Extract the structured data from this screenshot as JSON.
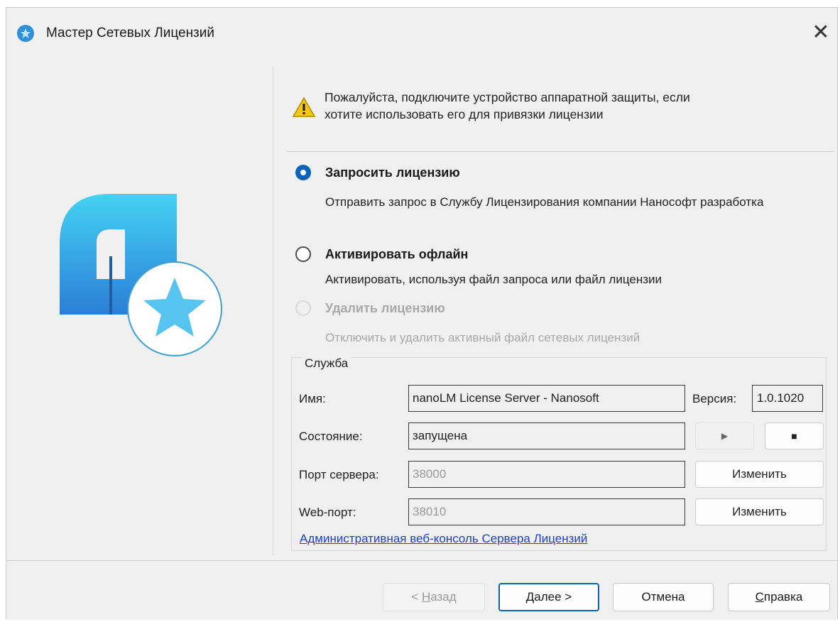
{
  "window": {
    "title": "Мастер Сетевых Лицензий",
    "close_glyph": "✕"
  },
  "warning": {
    "icon": "warning-icon",
    "line1": "Пожалуйста, подключите устройство аппаратной защиты, если",
    "line2": "хотите использовать его для привязки лицензии"
  },
  "options": [
    {
      "label": "Запросить лицензию",
      "desc": "Отправить запрос в Службу Лицензирования компании Нанософт разработка",
      "selected": true,
      "disabled": false
    },
    {
      "label": "Активировать офлайн",
      "desc": "Активировать, используя файл запроса или файл лицензии",
      "selected": false,
      "disabled": false
    },
    {
      "label": "Удалить лицензию",
      "desc": "Отключить и удалить активный файл сетевых лицензий",
      "selected": false,
      "disabled": true
    }
  ],
  "service": {
    "group_title": "Служба",
    "name_label": "Имя:",
    "name_value": "nanoLM License Server - Nanosoft",
    "version_label": "Версия:",
    "version_value": "1.0.1020",
    "state_label": "Состояние:",
    "state_value": "запущена",
    "play_glyph": "▶",
    "stop_glyph": "■",
    "port_label": "Порт сервера:",
    "port_value": "38000",
    "port_change": "Изменить",
    "web_label": "Web-порт:",
    "web_value": "38010",
    "web_change": "Изменить",
    "console_link": "Административная веб-консоль Сервера Лицензий"
  },
  "footer": {
    "back_pre": "< ",
    "back_key": "Н",
    "back_rest": "азад",
    "next_key": "Д",
    "next_rest": "алее >",
    "cancel": "Отмена",
    "help_key": "С",
    "help_rest": "правка"
  },
  "colors": {
    "accent": "#0a63b8",
    "logo_top": "#3fc9ef",
    "logo_bottom": "#2a7fd4",
    "link": "#1a3fd0"
  }
}
